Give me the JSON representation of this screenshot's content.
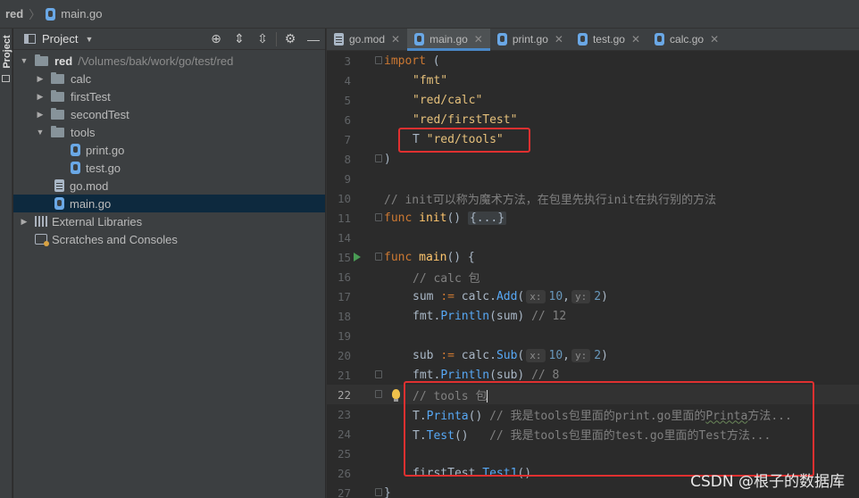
{
  "breadcrumb": {
    "root": "red",
    "file": "main.go"
  },
  "toolstrip": {
    "label": "Project"
  },
  "project_panel": {
    "title": "Project",
    "tree": [
      {
        "label": "red",
        "path": "/Volumes/bak/work/go/test/red"
      },
      {
        "label": "calc"
      },
      {
        "label": "firstTest"
      },
      {
        "label": "secondTest"
      },
      {
        "label": "tools"
      },
      {
        "label": "print.go"
      },
      {
        "label": "test.go"
      },
      {
        "label": "go.mod"
      },
      {
        "label": "main.go"
      },
      {
        "label": "External Libraries"
      },
      {
        "label": "Scratches and Consoles"
      }
    ]
  },
  "tabs": [
    {
      "label": "go.mod",
      "active": false
    },
    {
      "label": "main.go",
      "active": true
    },
    {
      "label": "print.go",
      "active": false
    },
    {
      "label": "test.go",
      "active": false
    },
    {
      "label": "calc.go",
      "active": false
    }
  ],
  "code": {
    "line_numbers": [
      "3",
      "4",
      "5",
      "6",
      "7",
      "8",
      "9",
      "10",
      "11",
      "14",
      "15",
      "16",
      "17",
      "18",
      "19",
      "20",
      "21",
      "22",
      "23",
      "24",
      "25",
      "26",
      "27"
    ],
    "l3_kw": "import",
    "l3_rest": " (",
    "l4": "\"fmt\"",
    "l5": "\"red/calc\"",
    "l6": "\"red/firstTest\"",
    "l7_alias": "T ",
    "l7_str": "\"red/tools\"",
    "l8": ")",
    "l10": "// init可以称为魔术方法，在包里先执行init在执行别的方法",
    "l11_kw": "func",
    "l11_fn": "init",
    "l11_paren": "() ",
    "l11_fold": "{...}",
    "l15_kw": "func",
    "l15_fn": "main",
    "l15_rest": "() {",
    "l16": "// calc 包",
    "l17_a": "sum ",
    "l17_op": ":=",
    "l17_pkg": " calc.",
    "l17_call": "Add",
    "l17_open": "(",
    "l17_hx": "x:",
    "l17_n1": "10",
    "l17_comma": ",",
    "l17_hy": "y:",
    "l17_n2": "2",
    "l17_close": ")",
    "l18_pkg": "fmt.",
    "l18_call": "Println",
    "l18_arg": "(sum) ",
    "l18_cm": "// 12",
    "l20_a": "sub ",
    "l20_op": ":=",
    "l20_pkg": " calc.",
    "l20_call": "Sub",
    "l20_open": "(",
    "l20_hx": "x:",
    "l20_n1": "10",
    "l20_comma": ",",
    "l20_hy": "y:",
    "l20_n2": "2",
    "l20_close": ")",
    "l21_pkg": "fmt.",
    "l21_call": "Println",
    "l21_arg": "(sub) ",
    "l21_cm": "// 8",
    "l22": "// tools 包",
    "l23_pkg": "T.",
    "l23_call": "Printa",
    "l23_arg": "() ",
    "l23_cm1": "// 我是tools包里面的print.go里面的",
    "l23_cm2": "Printa",
    "l23_cm3": "方法...",
    "l24_pkg": "T.",
    "l24_call": "Test",
    "l24_arg": "()   ",
    "l24_cm": "// 我是tools包里面的test.go里面的Test方法...",
    "l26_pkg": "firstTest.",
    "l26_call": "Test1",
    "l26_arg": "()",
    "l27": "}"
  },
  "watermark": "CSDN @根子的数据库",
  "colors": {
    "annotation_box": "#e03030",
    "selection": "#0d293e",
    "accent": "#4a88c7"
  }
}
